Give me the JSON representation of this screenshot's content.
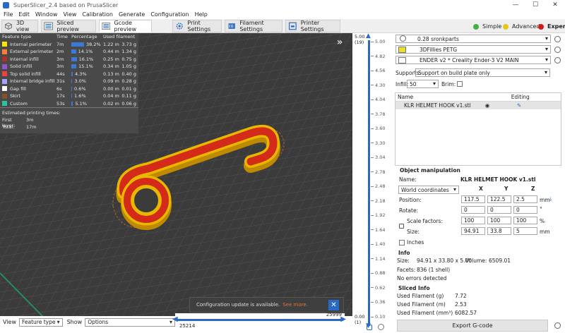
{
  "app": {
    "title": "SuperSlicer_2.4  based on PrusaSlicer",
    "window_buttons": [
      "—",
      "☐",
      "✕"
    ]
  },
  "menu": [
    "File",
    "Edit",
    "Window",
    "View",
    "Calibration",
    "Generate",
    "Configuration",
    "Help"
  ],
  "tabs": [
    {
      "label": "3D view",
      "icon": "cube-icon"
    },
    {
      "label": "Sliced preview",
      "icon": "layers-icon"
    },
    {
      "label": "Gcode preview",
      "icon": "layers-icon",
      "active": true
    },
    {
      "label": "Print Settings",
      "icon": "gear-icon"
    },
    {
      "label": "Filament Settings",
      "icon": "spool-icon"
    },
    {
      "label": "Printer Settings",
      "icon": "printer-icon"
    }
  ],
  "modes": {
    "simple": "Simple",
    "advanced": "Advanced",
    "expert": "Expert",
    "colors": {
      "simple": "#43b043",
      "advanced": "#e8c41e",
      "expert": "#d31a1a"
    }
  },
  "legend": {
    "headers": [
      "Feature type",
      "Time",
      "Percentage",
      "Used filament"
    ],
    "rows": [
      {
        "name": "Internal perimeter",
        "time": "7m",
        "pct": "38.2%",
        "pct_value": 38.2,
        "len": "1.22 m",
        "weight": "3.73 g",
        "color": "#ffe400"
      },
      {
        "name": "External perimeter",
        "time": "2m",
        "pct": "14.1%",
        "pct_value": 14.1,
        "len": "0.44 m",
        "weight": "1.34 g",
        "color": "#ff7d38"
      },
      {
        "name": "Internal infill",
        "time": "3m",
        "pct": "16.1%",
        "pct_value": 16.1,
        "len": "0.25 m",
        "weight": "0.75 g",
        "color": "#b03029"
      },
      {
        "name": "Solid infill",
        "time": "3m",
        "pct": "15.1%",
        "pct_value": 15.1,
        "len": "0.34 m",
        "weight": "1.05 g",
        "color": "#9654cc"
      },
      {
        "name": "Top solid infill",
        "time": "44s",
        "pct": "4.3%",
        "pct_value": 4.3,
        "len": "0.13 m",
        "weight": "0.40 g",
        "color": "#f04040"
      },
      {
        "name": "Internal bridge infill",
        "time": "31s",
        "pct": "3.0%",
        "pct_value": 3.0,
        "len": "0.09 m",
        "weight": "0.28 g",
        "color": "#a8a0ff"
      },
      {
        "name": "Gap fill",
        "time": "6s",
        "pct": "0.6%",
        "pct_value": 0.6,
        "len": "0.00 m",
        "weight": "0.01 g",
        "color": "#ffffff"
      },
      {
        "name": "Skirt",
        "time": "17s",
        "pct": "1.6%",
        "pct_value": 1.6,
        "len": "0.04 m",
        "weight": "0.11 g",
        "color": "#845321"
      },
      {
        "name": "Custom",
        "time": "53s",
        "pct": "5.1%",
        "pct_value": 5.1,
        "len": "0.02 m",
        "weight": "0.06 g",
        "color": "#27c4a0"
      }
    ],
    "estimated_label": "Estimated printing times:",
    "first_layer_label": "First layer:",
    "first_layer_value": "3m",
    "total_label": "Total:",
    "total_value": "17m"
  },
  "notification": {
    "text": "Configuration update is available.",
    "link": "See more."
  },
  "bottom": {
    "view_label": "View",
    "view_value": "Feature type",
    "show_label": "Show",
    "show_value": "Options",
    "h_max": "25999",
    "h_min": "25214"
  },
  "vslider": {
    "top_value": "5.00",
    "top_layer": "(19)",
    "bottom_value": "0.00",
    "bottom_layer": "(1)",
    "ticks": [
      "5.00",
      "4.82",
      "4.56",
      "4.30",
      "4.04",
      "3.78",
      "3.60",
      "3.30",
      "3.04",
      "2.78",
      "2.48",
      "2.18",
      "1.92",
      "1.64",
      "1.40",
      "1.14",
      "0.88",
      "0.62",
      "0.36",
      "0.10"
    ]
  },
  "panel": {
    "print_preset": "0.28 sronkparts",
    "filament_preset": "3DFillies PETG",
    "printer_preset": "ENDER v2 * Creality Ender-3 V2 MAIN",
    "supports_label": "Supports:",
    "supports_value": "Support on build plate only",
    "infill_label": "Infill:",
    "infill_value": "50",
    "brim_label": "Brim:",
    "list_name_header": "Name",
    "list_editing_header": "Editing",
    "object_name": "KLR HELMET HOOK v1.stl",
    "manip_title": "Object manipulation",
    "name_label": "Name:",
    "name_value": "KLR HELMET HOOK v1.stl",
    "coords_value": "World coordinates",
    "axes": [
      "X",
      "Y",
      "Z"
    ],
    "position_label": "Position:",
    "position": [
      "117.5",
      "122.5",
      "2.5"
    ],
    "position_unit": "mm",
    "rotate_label": "Rotate:",
    "rotate": [
      "0",
      "0",
      "0"
    ],
    "rotate_unit": "°",
    "scale_label": "Scale factors:",
    "scale": [
      "100",
      "100",
      "100"
    ],
    "scale_unit": "%",
    "size_label": "Size:",
    "size": [
      "94.91",
      "33.8",
      "5"
    ],
    "size_unit": "mm",
    "inches_label": "Inches",
    "info_title": "Info",
    "info_size_label": "Size:",
    "info_size_value": "94.91 x 33.80 x 5.00",
    "info_volume_label": "Volume:",
    "info_volume_value": "6509.01",
    "info_facets_label": "Facets:",
    "info_facets_value": "836 (1 shell)",
    "info_errors": "No errors detected",
    "sliced_title": "Sliced Info",
    "sliced_g_label": "Used Filament (g)",
    "sliced_g_value": "7.72",
    "sliced_m_label": "Used Filament (m)",
    "sliced_m_value": "2.53",
    "sliced_mm3_label": "Used Filament (mm³)",
    "sliced_mm3_value": "6082.57",
    "export_label": "Export G-code"
  }
}
